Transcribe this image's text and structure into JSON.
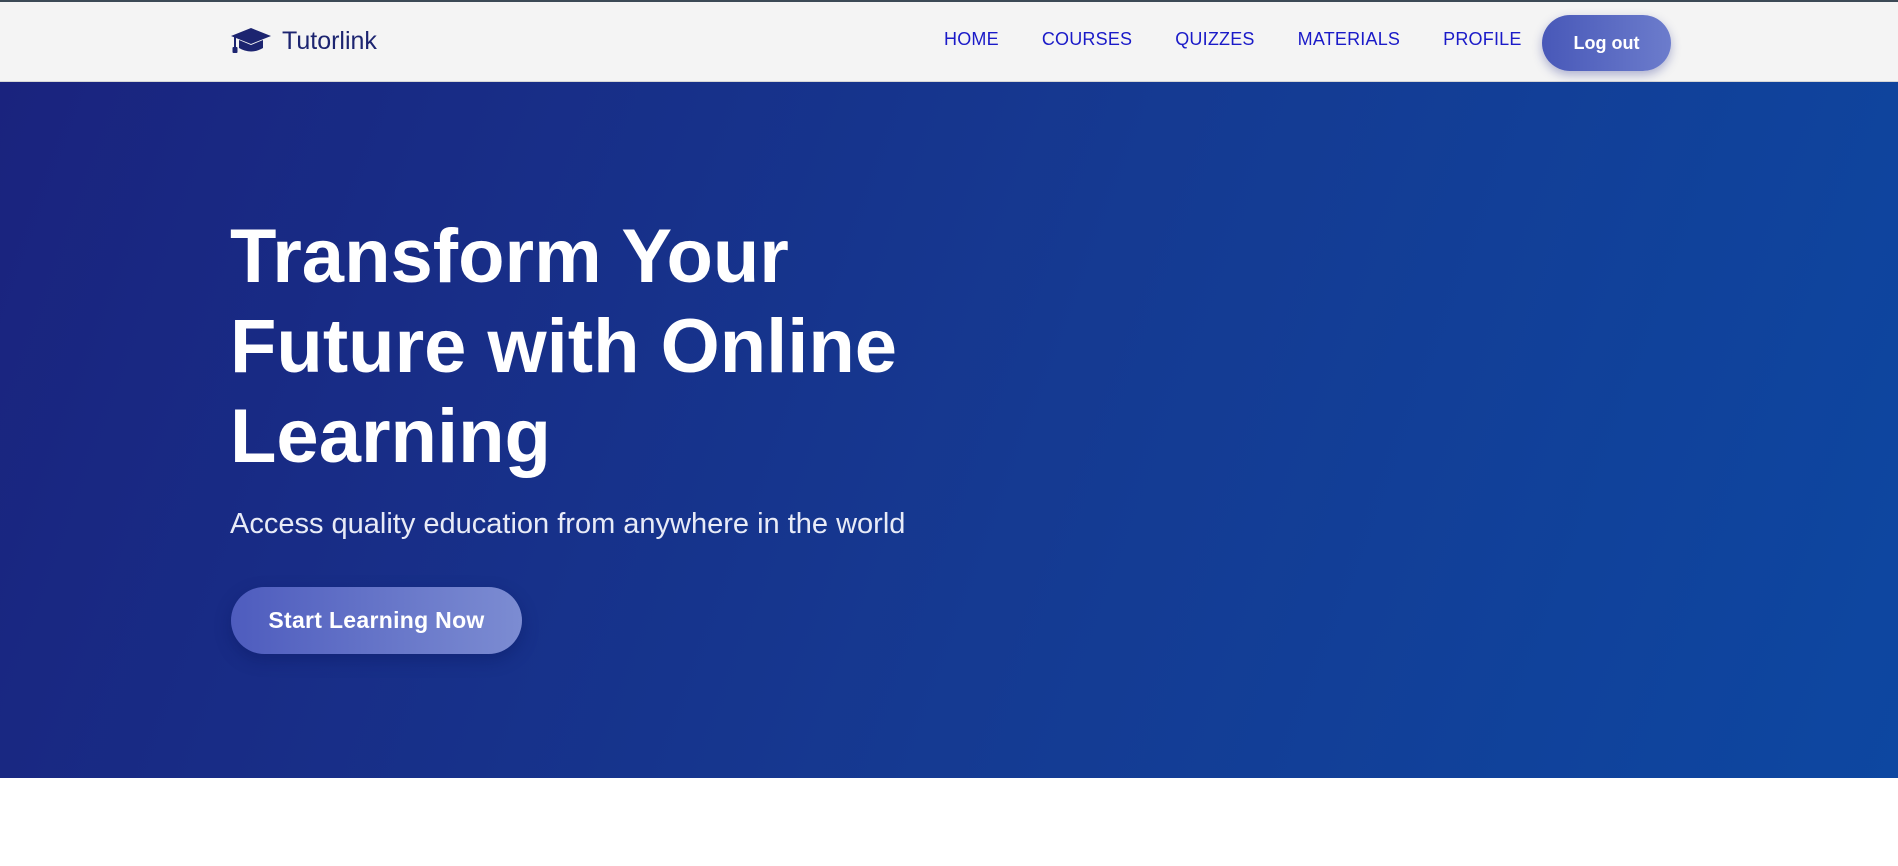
{
  "navbar": {
    "brand": {
      "icon": "graduation-cap-icon",
      "name": "Tutorlink"
    },
    "links": [
      {
        "label": "HOME"
      },
      {
        "label": "COURSES"
      },
      {
        "label": "QUIZZES"
      },
      {
        "label": "MATERIALS"
      },
      {
        "label": "PROFILE"
      }
    ],
    "logout_label": "Log out"
  },
  "hero": {
    "title": "Transform Your Future with Online Learning",
    "subtitle": "Access quality education from anywhere in the world",
    "cta_label": "Start Learning Now"
  },
  "colors": {
    "brand_text": "#1c2470",
    "nav_link": "#1a1ac8",
    "hero_gradient_start": "#1a237e",
    "hero_gradient_end": "#0d47a1",
    "button_gradient_start": "#4858b8",
    "button_gradient_end": "#6c7ccc"
  }
}
